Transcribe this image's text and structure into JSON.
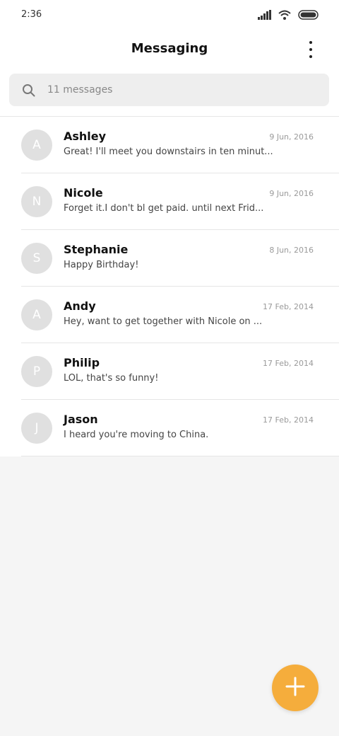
{
  "status_bar": {
    "time": "2:36",
    "icons": [
      "signal-icon",
      "wifi-icon",
      "battery-icon"
    ]
  },
  "header": {
    "title": "Messaging",
    "menu_icon": "more-vertical-icon"
  },
  "search": {
    "placeholder": "11 messages",
    "icon": "search-icon"
  },
  "messages": [
    {
      "initial": "A",
      "sender": "Ashley",
      "date": "9 Jun, 2016",
      "preview": "Great! I'll meet you downstairs in ten minut..."
    },
    {
      "initial": "N",
      "sender": "Nicole",
      "date": "9 Jun, 2016",
      "preview": "Forget it.I don't bl get paid. until next Frid..."
    },
    {
      "initial": "S",
      "sender": "Stephanie",
      "date": "8 Jun, 2016",
      "preview": "Happy Birthday!"
    },
    {
      "initial": "A",
      "sender": "Andy",
      "date": "17 Feb, 2014",
      "preview": "Hey, want to get together with Nicole on ..."
    },
    {
      "initial": "P",
      "sender": "Philip",
      "date": "17 Feb, 2014",
      "preview": "LOL, that's so funny!"
    },
    {
      "initial": "J",
      "sender": "Jason",
      "date": "17 Feb, 2014",
      "preview": "I heard you're moving to China."
    }
  ],
  "fab": {
    "icon": "plus-icon",
    "color": "#f5ad3c"
  },
  "colors": {
    "background": "#f5f5f5",
    "avatar": "#e0e0e0",
    "accent": "#f5ad3c"
  }
}
